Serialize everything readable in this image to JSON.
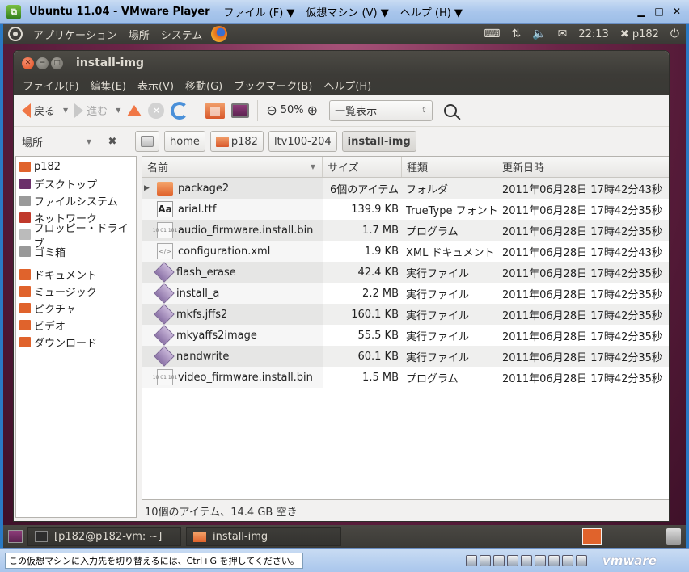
{
  "vm": {
    "title": "Ubuntu 11.04 - VMware Player",
    "menu": [
      "ファイル (F) ▼",
      "仮想マシン (V) ▼",
      "ヘルプ (H) ▼"
    ],
    "hint": "この仮想マシンに入力先を切り替えるには、Ctrl+G を押してください。",
    "brand": "vmware"
  },
  "top_panel": {
    "menus": [
      "アプリケーション",
      "場所",
      "システム"
    ],
    "time": "22:13",
    "user": "p182"
  },
  "window": {
    "title": "install-img",
    "menubar": [
      "ファイル(F)",
      "編集(E)",
      "表示(V)",
      "移動(G)",
      "ブックマーク(B)",
      "ヘルプ(H)"
    ]
  },
  "toolbar": {
    "back": "戻る",
    "forward": "進む",
    "zoom": "50%",
    "view": "一覧表示"
  },
  "locbar": {
    "places": "場所",
    "crumbs": [
      "home",
      "p182",
      "ltv100-204",
      "install-img"
    ]
  },
  "sidebar": {
    "group1": [
      {
        "label": "p182",
        "color": "#e0632c"
      },
      {
        "label": "デスクトップ",
        "color": "#6b2f6a"
      },
      {
        "label": "ファイルシステム",
        "color": "#9a9a9a"
      },
      {
        "label": "ネットワーク",
        "color": "#c0392b"
      },
      {
        "label": "フロッピー・ドライブ",
        "color": "#bbbbbb"
      },
      {
        "label": "ゴミ箱",
        "color": "#999999"
      }
    ],
    "group2": [
      {
        "label": "ドキュメント",
        "color": "#e0632c"
      },
      {
        "label": "ミュージック",
        "color": "#e0632c"
      },
      {
        "label": "ピクチャ",
        "color": "#e0632c"
      },
      {
        "label": "ビデオ",
        "color": "#e0632c"
      },
      {
        "label": "ダウンロード",
        "color": "#e0632c"
      }
    ]
  },
  "columns": {
    "name": "名前",
    "size": "サイズ",
    "type": "種類",
    "date": "更新日時"
  },
  "files": [
    {
      "name": "package2",
      "size": "6個のアイテム",
      "type": "フォルダ",
      "date": "2011年06月28日 17時42分43秒",
      "icon": "folder"
    },
    {
      "name": "arial.ttf",
      "size": "139.9 KB",
      "type": "TrueType フォント",
      "date": "2011年06月28日 17時42分35秒",
      "icon": "font"
    },
    {
      "name": "audio_firmware.install.bin",
      "size": "1.7 MB",
      "type": "プログラム",
      "date": "2011年06月28日 17時42分35秒",
      "icon": "bin"
    },
    {
      "name": "configuration.xml",
      "size": "1.9 KB",
      "type": "XML ドキュメント",
      "date": "2011年06月28日 17時42分43秒",
      "icon": "xml"
    },
    {
      "name": "flash_erase",
      "size": "42.4 KB",
      "type": "実行ファイル",
      "date": "2011年06月28日 17時42分35秒",
      "icon": "exec"
    },
    {
      "name": "install_a",
      "size": "2.2 MB",
      "type": "実行ファイル",
      "date": "2011年06月28日 17時42分35秒",
      "icon": "exec"
    },
    {
      "name": "mkfs.jffs2",
      "size": "160.1 KB",
      "type": "実行ファイル",
      "date": "2011年06月28日 17時42分35秒",
      "icon": "exec"
    },
    {
      "name": "mkyaffs2image",
      "size": "55.5 KB",
      "type": "実行ファイル",
      "date": "2011年06月28日 17時42分35秒",
      "icon": "exec"
    },
    {
      "name": "nandwrite",
      "size": "60.1 KB",
      "type": "実行ファイル",
      "date": "2011年06月28日 17時42分35秒",
      "icon": "exec"
    },
    {
      "name": "video_firmware.install.bin",
      "size": "1.5 MB",
      "type": "プログラム",
      "date": "2011年06月28日 17時42分35秒",
      "icon": "bin"
    }
  ],
  "status": "10個のアイテム、14.4 GB 空き",
  "taskbar": {
    "terminal": "[p182@p182-vm: ~]",
    "files": "install-img"
  }
}
